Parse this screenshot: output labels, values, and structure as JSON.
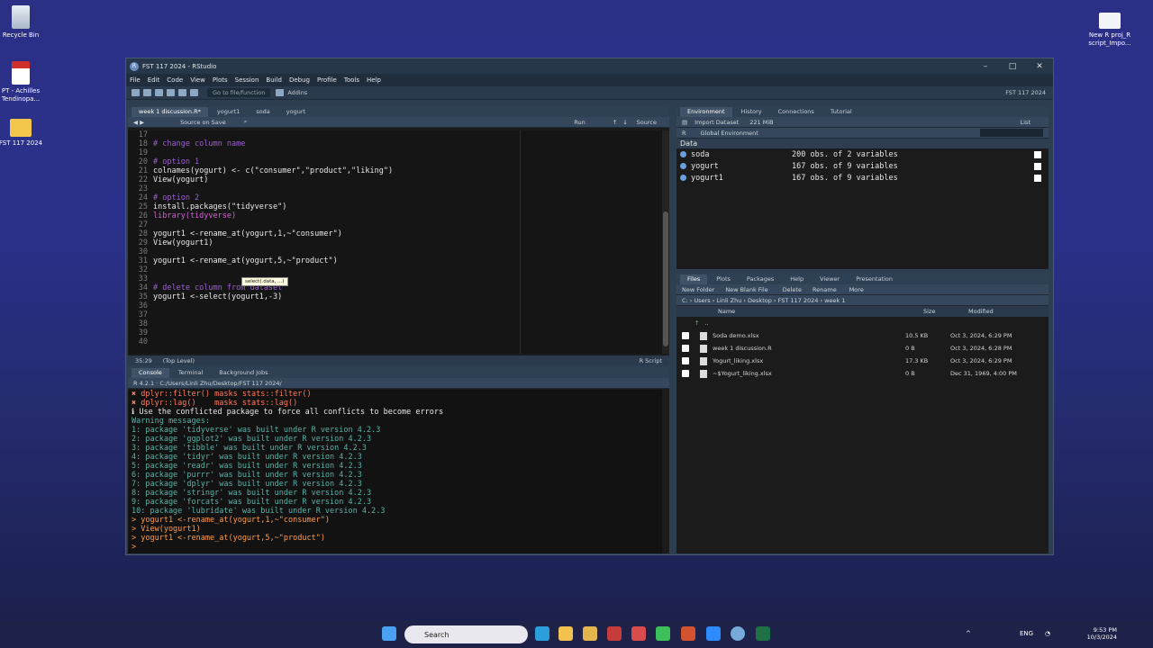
{
  "desktop": {
    "icons": [
      {
        "label": "Recycle Bin"
      },
      {
        "label": "PT - Achilles Tendinopa..."
      },
      {
        "label": "FST 117 2024"
      },
      {
        "label": "New R proj_R script_Impo..."
      }
    ]
  },
  "window": {
    "title": "FST 117 2024 - RStudio",
    "menu": [
      "File",
      "Edit",
      "Code",
      "View",
      "Plots",
      "Session",
      "Build",
      "Debug",
      "Profile",
      "Tools",
      "Help"
    ],
    "toolbar": {
      "goto_placeholder": "Go to file/function",
      "addins": "Addins",
      "project": "FST 117 2024"
    }
  },
  "editor": {
    "tabs": [
      "week 1 discussion.R*",
      "yogurt1",
      "soda",
      "yogurt"
    ],
    "subbar": {
      "source_on_save": "Source on Save",
      "run": "Run",
      "source": "Source"
    },
    "lines": [
      {
        "n": "17",
        "t": ""
      },
      {
        "n": "18",
        "t": "# change column name"
      },
      {
        "n": "19",
        "t": ""
      },
      {
        "n": "20",
        "t": "# option 1"
      },
      {
        "n": "21",
        "t": "colnames(yogurt) <- c(\"consumer\",\"product\",\"liking\")"
      },
      {
        "n": "22",
        "t": "View(yogurt)"
      },
      {
        "n": "23",
        "t": ""
      },
      {
        "n": "24",
        "t": "# option 2"
      },
      {
        "n": "25",
        "t": "install.packages(\"tidyverse\")"
      },
      {
        "n": "26",
        "t": "library(tidyverse)"
      },
      {
        "n": "27",
        "t": ""
      },
      {
        "n": "28",
        "t": "yogurt1 <-rename_at(yogurt,1,~\"consumer\")"
      },
      {
        "n": "29",
        "t": "View(yogurt1)"
      },
      {
        "n": "30",
        "t": ""
      },
      {
        "n": "31",
        "t": "yogurt1 <-rename_at(yogurt,5,~\"product\")"
      },
      {
        "n": "32",
        "t": ""
      },
      {
        "n": "33",
        "t": ""
      },
      {
        "n": "34",
        "t": "# delete column from dataset"
      },
      {
        "n": "35",
        "t": "yogurt1 <-select(yogurt1,-3)"
      },
      {
        "n": "36",
        "t": ""
      },
      {
        "n": "37",
        "t": ""
      },
      {
        "n": "38",
        "t": ""
      },
      {
        "n": "39",
        "t": ""
      },
      {
        "n": "40",
        "t": ""
      }
    ],
    "tooltip": "select(.data, ...)",
    "status": {
      "position": "35:29",
      "scope": "(Top Level)",
      "type": "R Script"
    }
  },
  "console": {
    "tabs": [
      "Console",
      "Terminal",
      "Background Jobs"
    ],
    "path": "R 4.2.1 · C:/Users/Linli Zhu/Desktop/FST 117 2024/",
    "lines": [
      {
        "k": "cr",
        "t": "✖ dplyr::filter() masks stats::filter()"
      },
      {
        "k": "cr",
        "t": "✖ dplyr::lag()    masks stats::lag()"
      },
      {
        "k": "cp",
        "t": "ℹ Use the conflicted package to force all conflicts to become errors"
      },
      {
        "k": "cw",
        "t": "Warning messages:"
      },
      {
        "k": "cw",
        "t": "1: package 'tidyverse' was built under R version 4.2.3"
      },
      {
        "k": "cw",
        "t": "2: package 'ggplot2' was built under R version 4.2.3"
      },
      {
        "k": "cw",
        "t": "3: package 'tibble' was built under R version 4.2.3"
      },
      {
        "k": "cw",
        "t": "4: package 'tidyr' was built under R version 4.2.3"
      },
      {
        "k": "cw",
        "t": "5: package 'readr' was built under R version 4.2.3"
      },
      {
        "k": "cw",
        "t": "6: package 'purrr' was built under R version 4.2.3"
      },
      {
        "k": "cw",
        "t": "7: package 'dplyr' was built under R version 4.2.3"
      },
      {
        "k": "cw",
        "t": "8: package 'stringr' was built under R version 4.2.3"
      },
      {
        "k": "cw",
        "t": "9: package 'forcats' was built under R version 4.2.3"
      },
      {
        "k": "cw",
        "t": "10: package 'lubridate' was built under R version 4.2.3"
      },
      {
        "k": "cpr",
        "t": "> yogurt1 <-rename_at(yogurt,1,~\"consumer\")"
      },
      {
        "k": "cpr",
        "t": "> View(yogurt1)"
      },
      {
        "k": "cpr",
        "t": "> yogurt1 <-rename_at(yogurt,5,~\"product\")"
      },
      {
        "k": "cpr",
        "t": "> "
      }
    ]
  },
  "environment": {
    "tabs": [
      "Environment",
      "History",
      "Connections",
      "Tutorial"
    ],
    "import": "Import Dataset",
    "memory": "221 MiB",
    "list": "List",
    "r_label": "R",
    "scope": "Global Environment",
    "section": "Data",
    "rows": [
      {
        "name": "soda",
        "value": "200 obs. of 2 variables"
      },
      {
        "name": "yogurt",
        "value": "167 obs. of 9 variables"
      },
      {
        "name": "yogurt1",
        "value": "167 obs. of 9 variables"
      }
    ]
  },
  "files": {
    "tabs": [
      "Files",
      "Plots",
      "Packages",
      "Help",
      "Viewer",
      "Presentation"
    ],
    "actions": [
      "New Folder",
      "New Blank File",
      "Delete",
      "Rename",
      "More"
    ],
    "breadcrumb": "C: › Users › Linli Zhu › Desktop › FST 117 2024 › week 1",
    "columns": {
      "name": "Name",
      "size": "Size",
      "modified": "Modified"
    },
    "up": "..",
    "rows": [
      {
        "name": "Soda demo.xlsx",
        "size": "10.5 KB",
        "modified": "Oct 3, 2024, 6:29 PM"
      },
      {
        "name": "week 1 discussion.R",
        "size": "0 B",
        "modified": "Oct 3, 2024, 6:28 PM"
      },
      {
        "name": "Yogurt_liking.xlsx",
        "size": "17.3 KB",
        "modified": "Oct 3, 2024, 6:29 PM"
      },
      {
        "name": "~$Yogurt_liking.xlsx",
        "size": "0 B",
        "modified": "Dec 31, 1969, 4:00 PM"
      }
    ]
  },
  "taskbar": {
    "search": "Search",
    "lang": "ENG",
    "time": "9:53 PM",
    "date": "10/3/2024"
  }
}
